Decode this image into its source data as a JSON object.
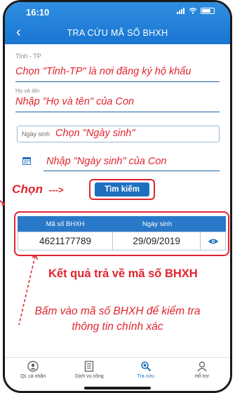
{
  "status": {
    "time": "16:10"
  },
  "header": {
    "back_icon": "chevron-left-icon",
    "title": "TRA CỨU MÃ SỐ BHXH"
  },
  "form": {
    "province": {
      "label": "Tỉnh - TP",
      "value": "Chọn \"Tỉnh-TP\" là nơi đăng ký hộ khẩu"
    },
    "name": {
      "label": "Họ và tên",
      "value": "Nhập \"Họ và tên\" của Con"
    },
    "dob_select": {
      "label": "Ngày sinh",
      "value": "Chọn \"Ngày sinh\""
    },
    "dob_input": {
      "icon": "calendar-icon",
      "value": "Nhập \"Ngày sinh\" của Con"
    }
  },
  "search": {
    "annotation": "Chọn",
    "arrow": "--->",
    "button_label": "Tìm kiếm"
  },
  "results": {
    "columns": [
      "Mã số BHXH",
      "Ngày sinh"
    ],
    "rows": [
      {
        "code": "4621177789",
        "dob": "29/09/2019",
        "action_icon": "eye-icon"
      }
    ]
  },
  "annotations": {
    "result_note": "Kết quả trả về mã số BHXH",
    "instruction_line1": "Bấm vào mã số BHXH để kiểm tra",
    "instruction_line2": "thông tin chính xác"
  },
  "tabbar": {
    "items": [
      {
        "label": "QL cá nhân",
        "icon": "user-badge-icon",
        "active": false
      },
      {
        "label": "Dịch vụ công",
        "icon": "document-icon",
        "active": false
      },
      {
        "label": "Tra cứu",
        "icon": "search-icon",
        "active": true
      },
      {
        "label": "Hỗ trợ",
        "icon": "support-icon",
        "active": false
      }
    ]
  },
  "colors": {
    "header": "#1976d2",
    "accent_red": "#e0242e",
    "button_blue": "#1f6fc0"
  }
}
